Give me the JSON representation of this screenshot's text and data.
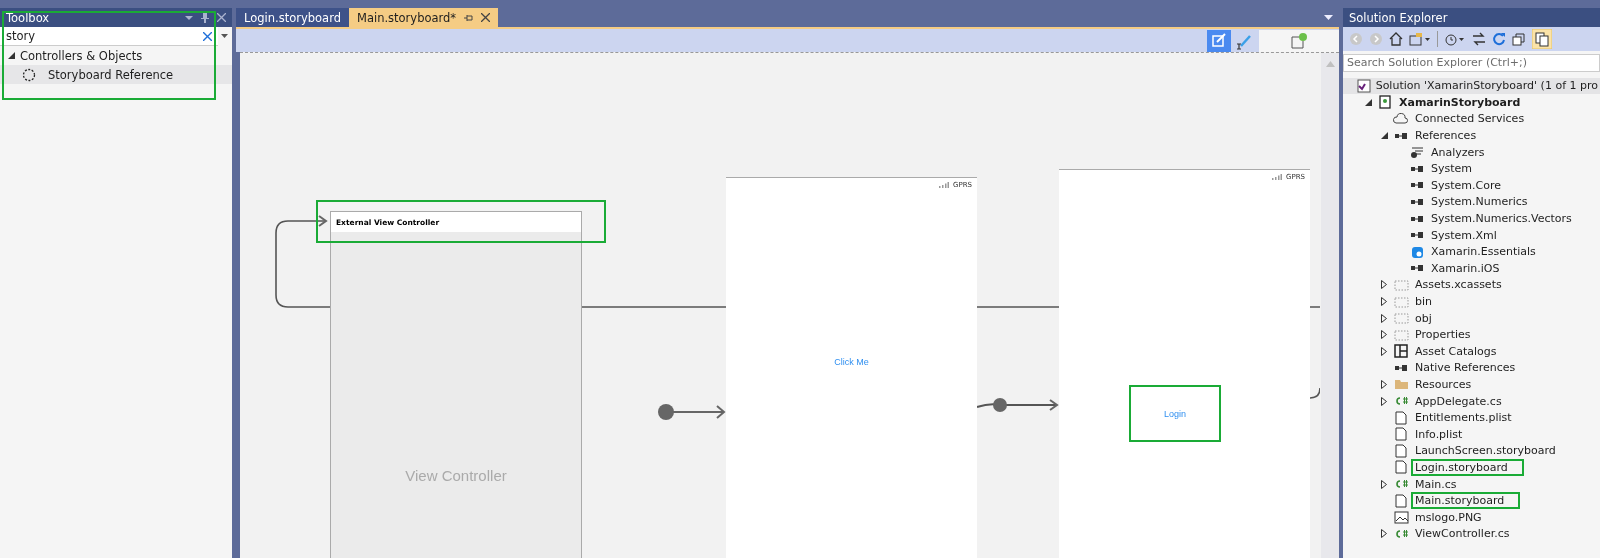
{
  "toolbox": {
    "title": "Toolbox",
    "highlighted": true,
    "search": {
      "value": "story"
    },
    "groups": [
      {
        "label": "Controllers & Objects",
        "expanded": true,
        "items": [
          {
            "label": "Storyboard Reference",
            "selected": true
          }
        ]
      }
    ]
  },
  "editor": {
    "tabs": [
      {
        "label": "Login.storyboard",
        "selected": false
      },
      {
        "label": "Main.storyboard*",
        "selected": true
      }
    ],
    "scenes": [
      {
        "kind": "external",
        "header": "External View Controller",
        "title": "View Controller",
        "highlighted": true
      },
      {
        "kind": "screen",
        "status": "GPRS",
        "control": "Click Me",
        "highlighted": false
      },
      {
        "kind": "screen",
        "status": "GPRS",
        "control": "Login",
        "highlighted": true
      }
    ]
  },
  "solution_explorer": {
    "title": "Solution Explorer",
    "search": {
      "placeholder": "Search Solution Explorer (Ctrl+;)"
    },
    "tree": [
      {
        "label": "Solution 'XamarinStoryboard' (1 of 1 pro",
        "kind": "solution",
        "selected": true,
        "highlighted": false,
        "children": [
          {
            "label": "XamarinStoryboard",
            "kind": "project",
            "expanded": true,
            "selected": false,
            "highlighted": false,
            "children": [
              {
                "label": "Connected Services",
                "kind": "service",
                "selected": false,
                "highlighted": false
              },
              {
                "label": "References",
                "kind": "reference",
                "expanded": true,
                "selected": false,
                "highlighted": false,
                "children": [
                  {
                    "label": "Analyzers",
                    "kind": "analyzer",
                    "selected": false,
                    "highlighted": false
                  },
                  {
                    "label": "System",
                    "kind": "reference",
                    "selected": false,
                    "highlighted": false
                  },
                  {
                    "label": "System.Core",
                    "kind": "reference",
                    "selected": false,
                    "highlighted": false
                  },
                  {
                    "label": "System.Numerics",
                    "kind": "reference",
                    "selected": false,
                    "highlighted": false
                  },
                  {
                    "label": "System.Numerics.Vectors",
                    "kind": "reference",
                    "selected": false,
                    "highlighted": false
                  },
                  {
                    "label": "System.Xml",
                    "kind": "reference",
                    "selected": false,
                    "highlighted": false
                  },
                  {
                    "label": "Xamarin.Essentials",
                    "kind": "package",
                    "selected": false,
                    "highlighted": false
                  },
                  {
                    "label": "Xamarin.iOS",
                    "kind": "reference",
                    "selected": false,
                    "highlighted": false
                  }
                ]
              },
              {
                "label": "Assets.xcassets",
                "kind": "folder-ref",
                "expanded": false,
                "selected": false,
                "highlighted": false
              },
              {
                "label": "bin",
                "kind": "folder-ref",
                "expanded": false,
                "selected": false,
                "highlighted": false
              },
              {
                "label": "obj",
                "kind": "folder-ref",
                "expanded": false,
                "selected": false,
                "highlighted": false
              },
              {
                "label": "Properties",
                "kind": "folder-ref",
                "expanded": false,
                "selected": false,
                "highlighted": false
              },
              {
                "label": "Asset Catalogs",
                "kind": "catalog",
                "expanded": false,
                "selected": false,
                "highlighted": false
              },
              {
                "label": "Native References",
                "kind": "reference",
                "selected": false,
                "highlighted": false
              },
              {
                "label": "Resources",
                "kind": "folder",
                "expanded": false,
                "selected": false,
                "highlighted": false
              },
              {
                "label": "AppDelegate.cs",
                "kind": "csharp",
                "expanded": false,
                "selected": false,
                "highlighted": false
              },
              {
                "label": "Entitlements.plist",
                "kind": "file",
                "selected": false,
                "highlighted": false
              },
              {
                "label": "Info.plist",
                "kind": "file",
                "selected": false,
                "highlighted": false
              },
              {
                "label": "LaunchScreen.storyboard",
                "kind": "file",
                "selected": false,
                "highlighted": false
              },
              {
                "label": "Login.storyboard",
                "kind": "file",
                "selected": false,
                "highlighted": true
              },
              {
                "label": "Main.cs",
                "kind": "csharp",
                "expanded": false,
                "selected": false,
                "highlighted": false
              },
              {
                "label": "Main.storyboard",
                "kind": "file",
                "selected": false,
                "highlighted": true
              },
              {
                "label": "mslogo.PNG",
                "kind": "image",
                "selected": false,
                "highlighted": false
              },
              {
                "label": "ViewController.cs",
                "kind": "csharp",
                "expanded": false,
                "selected": false,
                "highlighted": false
              }
            ]
          }
        ]
      }
    ]
  }
}
